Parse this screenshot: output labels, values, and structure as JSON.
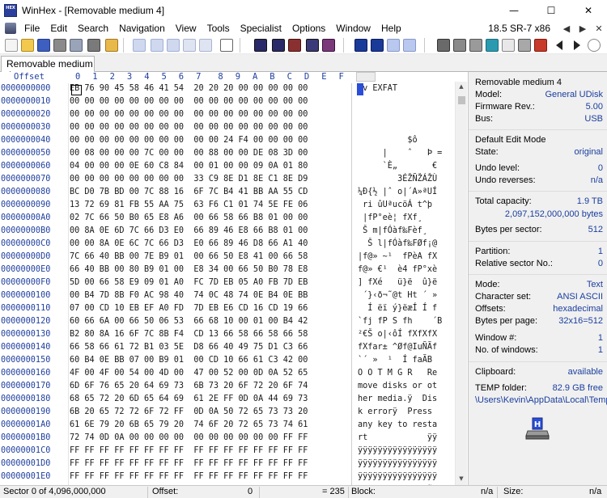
{
  "window": {
    "title": "WinHex - [Removable medium 4]",
    "app_icon_text": "HEX",
    "controls": {
      "minimize": "—",
      "maximize": "☐",
      "close": "✕"
    }
  },
  "menu": {
    "items": [
      "File",
      "Edit",
      "Search",
      "Navigation",
      "View",
      "Tools",
      "Specialist",
      "Options",
      "Window",
      "Help"
    ],
    "version": "18.5 SR-7 x86",
    "mdi_controls": [
      "◀",
      "▶",
      "✕"
    ]
  },
  "toolbar": {
    "icons": [
      "new-file-icon",
      "open-file-icon",
      "save-icon",
      "print-icon",
      "properties-icon",
      "open-disk-icon",
      "undo-icon",
      "copy-icon",
      "paste-icon",
      "copy-block-icon",
      "cut-icon",
      "insert-icon",
      "find-text-icon",
      "find-hex-icon",
      "replace-text-icon",
      "replace-hex-icon",
      "goto-offset-icon",
      "goto-sector-icon",
      "back-icon",
      "forward-icon",
      "disk-editor-icon",
      "ram-editor-icon",
      "drive-icon",
      "calculator-icon",
      "hash-icon",
      "analyze-icon",
      "options-icon",
      "previous-icon",
      "next-icon",
      "help-icon"
    ]
  },
  "tabs": [
    {
      "label": "Removable medium 4"
    }
  ],
  "hexview": {
    "offset_label": "Offset",
    "columns": [
      "0",
      "1",
      "2",
      "3",
      "4",
      "5",
      "6",
      "7",
      "8",
      "9",
      "A",
      "B",
      "C",
      "D",
      "E",
      "F"
    ],
    "rows": [
      {
        "offset": "0000000000",
        "hex": "EB 76 90 45 58 46 41 54  20 20 20 00 00 00 00 00",
        "text": "ëv EXFAT"
      },
      {
        "offset": "0000000010",
        "hex": "00 00 00 00 00 00 00 00  00 00 00 00 00 00 00 00",
        "text": ""
      },
      {
        "offset": "0000000020",
        "hex": "00 00 00 00 00 00 00 00  00 00 00 00 00 00 00 00",
        "text": ""
      },
      {
        "offset": "0000000030",
        "hex": "00 00 00 00 00 00 00 00  00 00 00 00 00 00 00 00",
        "text": ""
      },
      {
        "offset": "0000000040",
        "hex": "00 00 00 00 00 00 00 00  00 00 24 F4 00 00 00 00",
        "text": "          $ô"
      },
      {
        "offset": "0000000050",
        "hex": "00 08 00 00 00 7C 00 00  00 88 00 00 DE 08 3D 00",
        "text": "     |    ˆ   Þ =  "
      },
      {
        "offset": "0000000060",
        "hex": "04 00 00 00 0E 60 C8 84  00 01 00 00 09 0A 01 80",
        "text": "     `È„       €"
      },
      {
        "offset": "0000000070",
        "hex": "00 00 00 00 00 00 00 00  33 C9 8E D1 8E C1 8E D9",
        "text": "        3ÉŽÑŽÁŽÙ"
      },
      {
        "offset": "0000000080",
        "hex": "BC D0 7B BD 00 7C 88 16  6F 7C B4 41 BB AA 55 CD",
        "text": "¼Ð{½ |ˆ o|´A»ªUÍ"
      },
      {
        "offset": "0000000090",
        "hex": "13 72 69 81 FB 55 AA 75  63 F6 C1 01 74 5E FE 06",
        "text": " ri ûUªucöÁ t^þ "
      },
      {
        "offset": "00000000A0",
        "hex": "02 7C 66 50 B0 65 E8 A6  00 66 58 66 B8 01 00 00",
        "text": " |fP°eè¦ fXf¸  "
      },
      {
        "offset": "00000000B0",
        "hex": "00 8A 0E 6D 7C 66 D3 E0  66 89 46 E8 66 B8 01 00",
        "text": " Š m|fÓàf‰Fèf¸  "
      },
      {
        "offset": "00000000C0",
        "hex": "00 00 8A 0E 6C 7C 66 D3  E0 66 89 46 D8 66 A1 40",
        "text": "  Š l|fÓàf‰FØf¡@"
      },
      {
        "offset": "00000000D0",
        "hex": "7C 66 40 BB 00 7E B9 01  00 66 50 E8 41 00 66 58",
        "text": "|f@» ~¹  fPèA fX"
      },
      {
        "offset": "00000000E0",
        "hex": "66 40 BB 00 80 B9 01 00  E8 34 00 66 50 B0 78 E8",
        "text": "f@» €¹  è4 fP°xè"
      },
      {
        "offset": "00000000F0",
        "hex": "5D 00 66 58 E9 09 01 A0  FC 7D EB 05 A0 FB 7D EB",
        "text": "] fXé   ü}ë  û}ë"
      },
      {
        "offset": "0000000100",
        "hex": "00 B4 7D 8B F0 AC 98 40  74 0C 48 74 0E B4 0E BB",
        "text": " ´}‹ð¬˜@t Ht ´ »"
      },
      {
        "offset": "0000000110",
        "hex": "07 00 CD 10 EB EF A0 FD  7D EB E6 CD 16 CD 19 66",
        "text": "  Í ëï ý}ëæÍ Í f"
      },
      {
        "offset": "0000000120",
        "hex": "60 66 6A 00 66 50 06 53  66 68 10 00 01 00 B4 42",
        "text": "`fj fP S fh    ´B"
      },
      {
        "offset": "0000000130",
        "hex": "B2 80 8A 16 6F 7C 8B F4  CD 13 66 58 66 58 66 58",
        "text": "²€Š o|‹ôÍ fXfXfX"
      },
      {
        "offset": "0000000140",
        "hex": "66 58 66 61 72 B1 03 5E  D8 66 40 49 75 D1 C3 66",
        "text": "fXfar± ^Øf@IuÑÃf"
      },
      {
        "offset": "0000000150",
        "hex": "60 B4 0E BB 07 00 B9 01  00 CD 10 66 61 C3 42 00",
        "text": "`´ »  ¹  Í faÃB "
      },
      {
        "offset": "0000000160",
        "hex": "4F 00 4F 00 54 00 4D 00  47 00 52 00 0D 0A 52 65",
        "text": "O O T M G R   Re"
      },
      {
        "offset": "0000000170",
        "hex": "6D 6F 76 65 20 64 69 73  6B 73 20 6F 72 20 6F 74",
        "text": "move disks or ot"
      },
      {
        "offset": "0000000180",
        "hex": "68 65 72 20 6D 65 64 69  61 2E FF 0D 0A 44 69 73",
        "text": "her media.ÿ  Dis"
      },
      {
        "offset": "0000000190",
        "hex": "6B 20 65 72 72 6F 72 FF  0D 0A 50 72 65 73 73 20",
        "text": "k errorÿ  Press "
      },
      {
        "offset": "00000001A0",
        "hex": "61 6E 79 20 6B 65 79 20  74 6F 20 72 65 73 74 61",
        "text": "any key to resta"
      },
      {
        "offset": "00000001B0",
        "hex": "72 74 0D 0A 00 00 00 00  00 00 00 00 00 00 FF FF",
        "text": "rt            ÿÿ"
      },
      {
        "offset": "00000001C0",
        "hex": "FF FF FF FF FF FF FF FF  FF FF FF FF FF FF FF FF",
        "text": "ÿÿÿÿÿÿÿÿÿÿÿÿÿÿÿÿ"
      },
      {
        "offset": "00000001D0",
        "hex": "FF FF FF FF FF FF FF FF  FF FF FF FF FF FF FF FF",
        "text": "ÿÿÿÿÿÿÿÿÿÿÿÿÿÿÿÿ"
      },
      {
        "offset": "00000001E0",
        "hex": "FF FF FF FF FF FF FF FF  FF FF FF FF FF FF FF FF",
        "text": "ÿÿÿÿÿÿÿÿÿÿÿÿÿÿÿÿ"
      },
      {
        "offset": "00000001F0",
        "hex": "FF FF FF FF FF FF FF FF  FF FF 00 00 6C 8B 98 55 AA",
        "text": "ÿÿÿÿÿÿÿÿÿÿ  l‹˜Uª"
      }
    ]
  },
  "infopanel": {
    "device": {
      "name": "Removable medium 4",
      "model_label": "Model:",
      "model": "General UDisk",
      "firmware_label": "Firmware Rev.:",
      "firmware": "5.00",
      "bus_label": "Bus:",
      "bus": "USB"
    },
    "edit": {
      "mode": "Default Edit Mode",
      "state_label": "State:",
      "state": "original"
    },
    "undo": {
      "level_label": "Undo level:",
      "level": "0",
      "reverses_label": "Undo reverses:",
      "reverses": "n/a"
    },
    "capacity": {
      "total_label": "Total capacity:",
      "total": "1.9 TB",
      "bytes": "2,097,152,000,000 bytes"
    },
    "sector": {
      "label": "Bytes per sector:",
      "value": "512"
    },
    "partition": {
      "partition_label": "Partition:",
      "partition": "1",
      "relsector_label": "Relative sector No.:",
      "relsector": "0"
    },
    "view": {
      "mode_label": "Mode:",
      "mode": "Text",
      "charset_label": "Character set:",
      "charset": "ANSI ASCII",
      "offsets_label": "Offsets:",
      "offsets": "hexadecimal",
      "bpp_label": "Bytes per page:",
      "bpp": "32x16=512"
    },
    "window": {
      "num_label": "Window #:",
      "num": "1",
      "count_label": "No. of windows:",
      "count": "1"
    },
    "clip": {
      "clipboard_label": "Clipboard:",
      "clipboard": "available",
      "temp_label": "TEMP folder:",
      "temp_free": "82.9 GB free",
      "temp_path": "\\Users\\Kevin\\AppData\\Local\\Temp"
    }
  },
  "statusbar": {
    "sector": "Sector 0 of 4,096,000,000",
    "offset_label": "Offset:",
    "offset": "0",
    "value": "= 235",
    "block_label": "Block:",
    "block": "n/a",
    "size_label": "Size:",
    "size": "n/a"
  },
  "colors": {
    "offset_blue": "#1f3f9f",
    "value_blue": "#1a3e9f",
    "selection": "#2a4ed8"
  }
}
